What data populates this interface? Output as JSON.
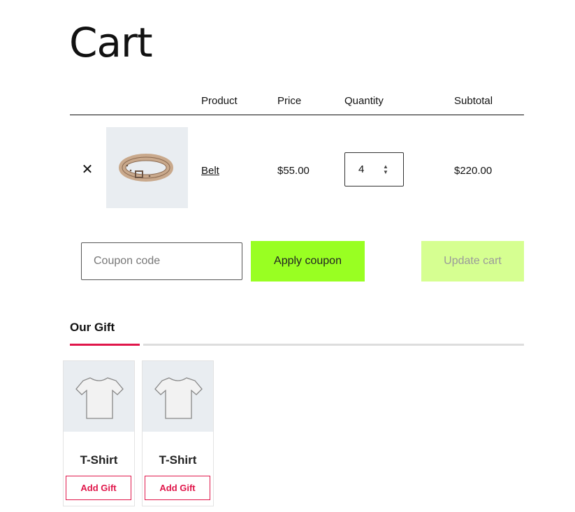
{
  "page": {
    "title": "Cart"
  },
  "cart": {
    "headers": {
      "product": "Product",
      "price": "Price",
      "quantity": "Quantity",
      "subtotal": "Subtotal"
    },
    "items": [
      {
        "remove_glyph": "✕",
        "name": "Belt",
        "price": "$55.00",
        "quantity": "4",
        "subtotal": "$220.00",
        "image_icon": "belt-image"
      }
    ]
  },
  "coupon": {
    "placeholder": "Coupon code",
    "apply_label": "Apply coupon"
  },
  "update_cart_label": "Update cart",
  "gifts": {
    "tab_title": "Our Gift",
    "items": [
      {
        "name": "T-Shirt",
        "button": "Add Gift",
        "image_icon": "tshirt-image"
      },
      {
        "name": "T-Shirt",
        "button": "Add Gift",
        "image_icon": "tshirt-image"
      }
    ]
  },
  "colors": {
    "accent": "#e0164a",
    "apply_bg": "#99ff22",
    "update_bg": "#d6ff91",
    "thumb_bg": "#e9edf1"
  }
}
